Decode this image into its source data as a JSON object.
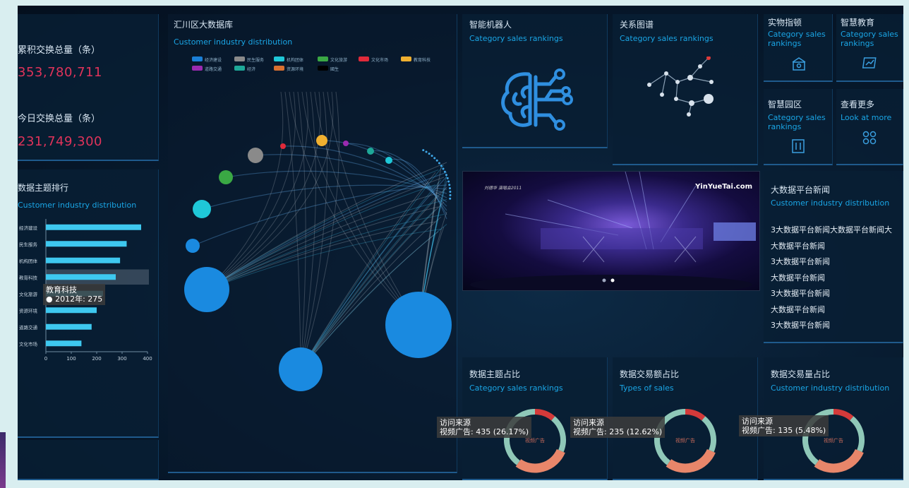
{
  "colors": {
    "accent": "#1aa6e6",
    "number": "#e0335a",
    "bar": "#3ec8ef",
    "ring_red": "#d43a3a",
    "ring_green": "#8fc8b8",
    "ring_salmon": "#e8866a"
  },
  "stats": {
    "total_label": "累积交换总量（条）",
    "total_value": "353,780,711",
    "today_label": "今日交换总量（条）",
    "today_value": "231,749,300"
  },
  "rank_panel": {
    "title": "数据主题排行",
    "subtitle": "Customer industry distribution",
    "tooltip_title": "教育科技",
    "tooltip_value": "2012年: 275"
  },
  "chart_data": {
    "type": "bar",
    "orientation": "horizontal",
    "categories": [
      "经济建设",
      "民生服务",
      "机构团体",
      "教育科技",
      "文化旅游",
      "资源环境",
      "道路交通",
      "文化市场"
    ],
    "values": [
      375,
      318,
      292,
      275,
      225,
      200,
      180,
      140
    ],
    "xlim": [
      0,
      400
    ],
    "xticks": [
      "0",
      "100",
      "200",
      "300",
      "400"
    ],
    "highlighted": "教育科技"
  },
  "graph_panel": {
    "title": "汇川区大数据库",
    "subtitle": "Customer industry distribution",
    "legend": [
      {
        "label": "经济建设",
        "color": "#1a7fd6"
      },
      {
        "label": "民生服务",
        "color": "#8a8a8a"
      },
      {
        "label": "机构团体",
        "color": "#1fc8d8"
      },
      {
        "label": "文化旅游",
        "color": "#3aa844"
      },
      {
        "label": "文化市场",
        "color": "#e02a3a"
      },
      {
        "label": "教育科技",
        "color": "#f0b030"
      },
      {
        "label": "道路交通",
        "color": "#9a2ab0"
      },
      {
        "label": "经济",
        "color": "#1ea898"
      },
      {
        "label": "资源环境",
        "color": "#d87030"
      },
      {
        "label": "國生",
        "color": "#000000"
      }
    ]
  },
  "tiles": {
    "robot": {
      "title": "智能机器人",
      "subtitle": "Category sales rankings",
      "icon": "brain-circuit-icon"
    },
    "relation": {
      "title": "关系图谱",
      "subtitle": "Category sales rankings",
      "icon": "network-graph-icon"
    },
    "iot": {
      "title": "实物指顿",
      "subtitle": "Category sales rankings",
      "icon": "house-icon"
    },
    "edu": {
      "title": "智慧教育",
      "subtitle": "Category sales rankings",
      "icon": "chart-screen-icon"
    },
    "park": {
      "title": "智慧园区",
      "subtitle": "Category sales rankings",
      "icon": "building-icon"
    },
    "more": {
      "title": "查看更多",
      "subtitle": "Look at more",
      "icon": "grid-four-icon"
    }
  },
  "video": {
    "watermark": "YinYueTai.com",
    "caption": "刘德华 演唱会2011"
  },
  "news": {
    "title": "大数据平台新闻",
    "subtitle": "Customer industry distribution",
    "items": [
      "3大数据平台新闻大数据平台新闻大",
      "大数据平台新闻",
      "3大数据平台新闻",
      "大数据平台新闻",
      "3大数据平台新闻",
      "大数据平台新闻",
      "3大数据平台新闻"
    ]
  },
  "donuts": [
    {
      "title": "数据主题占比",
      "subtitle": "Category sales rankings",
      "tip_title": "访问来源",
      "tip_value": "视频广告: 435 (26.17%)",
      "center": "视频广告"
    },
    {
      "title": "数据交易额占比",
      "subtitle": "Types of sales",
      "tip_title": "访问来源",
      "tip_value": "视频广告: 235 (12.62%)",
      "center": "视频广告"
    },
    {
      "title": "数据交易量占比",
      "subtitle": "Customer industry distribution",
      "tip_title": "访问来源",
      "tip_value": "视频广告: 135 (5.48%)",
      "center": "视频广告"
    }
  ]
}
